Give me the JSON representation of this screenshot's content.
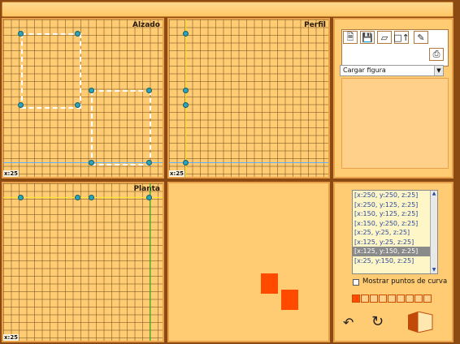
{
  "panels": {
    "alzado": "Alzado",
    "perfil": "Perfil",
    "planta": "Planta"
  },
  "scale_label": "x:25",
  "toolbar": {
    "icons": [
      "new-file-icon",
      "save-icon",
      "plane-icon",
      "extrude-icon",
      "eraser-icon",
      "print-icon"
    ]
  },
  "load_figure": {
    "selected": "Cargar figura"
  },
  "point_list": {
    "items": [
      "[x:250, y:250, z:25]",
      "[x:250, y:125, z:25]",
      "[x:150, y:125, z:25]",
      "[x:150, y:250, z:25]",
      "[x:25, y:25, z:25]",
      "[x:125, y:25, z:25]",
      "[x:125, y:150, z:25]",
      "[x:25, y:150, z:25]"
    ],
    "selected_index": 6
  },
  "show_curve_points": {
    "label": "Mostrar puntos de curva",
    "checked": false
  },
  "color_swatches": {
    "count": 9,
    "selected_index": 0
  },
  "colors": {
    "accent": "#ff4a00",
    "panel": "#ffcc73",
    "background": "#8a4a12"
  }
}
